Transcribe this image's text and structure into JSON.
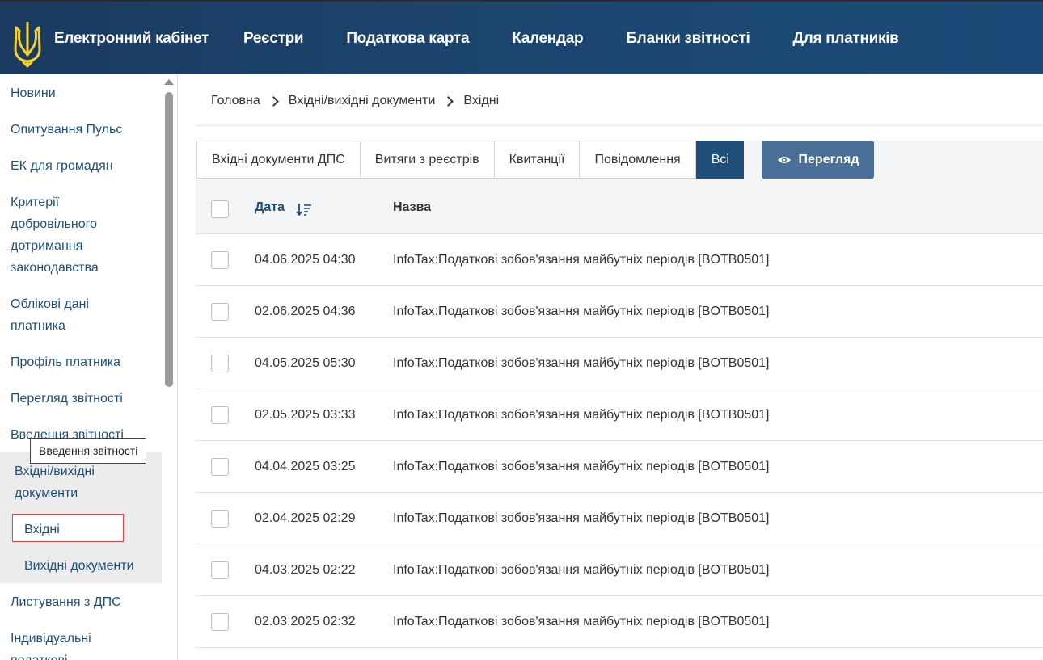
{
  "header": {
    "brand": "Електронний кабінет",
    "nav": [
      "Реєстри",
      "Податкова карта",
      "Календар",
      "Бланки звітності",
      "Для платників"
    ]
  },
  "sidebar": {
    "items": [
      "Новини",
      "Опитування Пульс",
      "ЕК для громадян",
      "Критерії добровільного дотримання законодавства",
      "Облікові дані платника",
      "Профіль платника",
      "Перегляд звітності",
      "Введення звітності"
    ],
    "group_label": "Вхідні/вихідні документи",
    "sub_items": [
      "Вхідні",
      "Вихідні документи"
    ],
    "after_items": [
      "Листування з ДПС",
      "Індивідуальні податкові"
    ],
    "tooltip": "Введення звітності"
  },
  "breadcrumb": [
    "Головна",
    "Вхідні/вихідні документи",
    "Вхідні"
  ],
  "tabs": [
    "Вхідні документи ДПС",
    "Витяги з реєстрів",
    "Квитанції",
    "Повідомлення",
    "Всі"
  ],
  "active_tab": "Всі",
  "view_button": "Перегляд",
  "table": {
    "headers": {
      "date": "Дата",
      "name": "Назва"
    },
    "rows": [
      {
        "date": "04.06.2025 04:30",
        "name": "InfoTax:Податкові зобов'язання майбутніх періодів [BOTB0501]"
      },
      {
        "date": "02.06.2025 04:36",
        "name": "InfoTax:Податкові зобов'язання майбутніх періодів [BOTB0501]"
      },
      {
        "date": "04.05.2025 05:30",
        "name": "InfoTax:Податкові зобов'язання майбутніх періодів [BOTB0501]"
      },
      {
        "date": "02.05.2025 03:33",
        "name": "InfoTax:Податкові зобов'язання майбутніх періодів [BOTB0501]"
      },
      {
        "date": "04.04.2025 03:25",
        "name": "InfoTax:Податкові зобов'язання майбутніх періодів [BOTB0501]"
      },
      {
        "date": "02.04.2025 02:29",
        "name": "InfoTax:Податкові зобов'язання майбутніх періодів [BOTB0501]"
      },
      {
        "date": "04.03.2025 02:22",
        "name": "InfoTax:Податкові зобов'язання майбутніх періодів [BOTB0501]"
      },
      {
        "date": "02.03.2025 02:32",
        "name": "InfoTax:Податкові зобов'язання майбутніх періодів [BOTB0501]"
      }
    ]
  },
  "colors": {
    "header": "#1c4670",
    "accent": "#1f4e79",
    "view_button": "#4a6f97",
    "active_outline": "#e0474c",
    "trident": "#f5d130"
  }
}
